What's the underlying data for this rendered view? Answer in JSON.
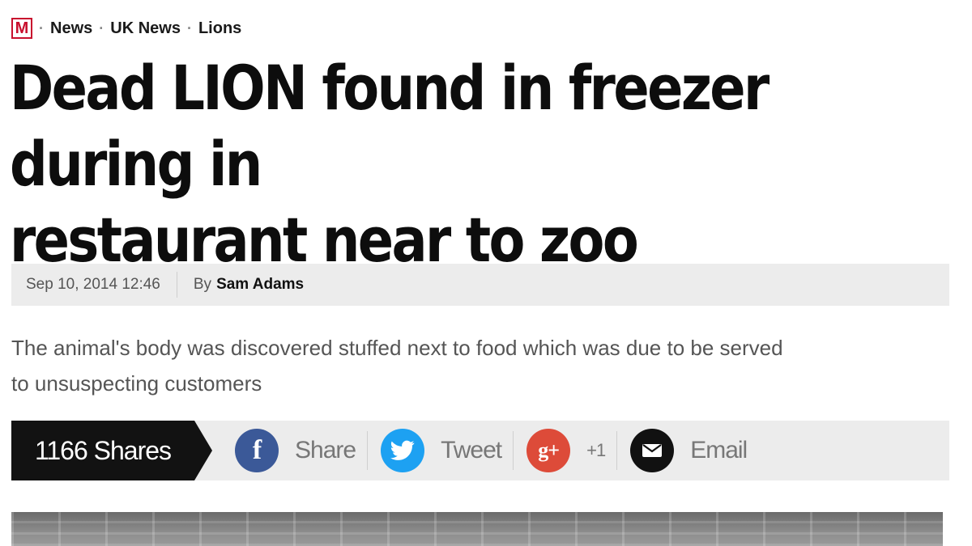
{
  "breadcrumb": {
    "logo": "M",
    "separator": "·",
    "items": [
      "News",
      "UK News",
      "Lions"
    ]
  },
  "article": {
    "headline_line1": "Dead LION found in freezer during in",
    "headline_line2": "restaurant near to zoo",
    "date": "Sep 10, 2014 12:46",
    "by_label": "By",
    "author": "Sam Adams",
    "summary_line1": "The animal's body was discovered stuffed next to food which was due to be served",
    "summary_line2": "to unsuspecting customers"
  },
  "share": {
    "count_label": "1166 Shares",
    "facebook_label": "Share",
    "facebook_glyph": "f",
    "twitter_label": "Tweet",
    "googleplus_label": "+1",
    "googleplus_glyph": "g+",
    "email_label": "Email"
  },
  "icons": {
    "facebook": "facebook-icon",
    "twitter": "twitter-icon",
    "googleplus": "google-plus-icon",
    "email": "email-icon"
  },
  "colors": {
    "logo_red": "#c8102e",
    "facebook": "#3b5998",
    "twitter": "#1da1f2",
    "googleplus": "#dd4b39",
    "email": "#111111",
    "share_count_bg": "#121212",
    "bar_bg": "#ececec"
  }
}
